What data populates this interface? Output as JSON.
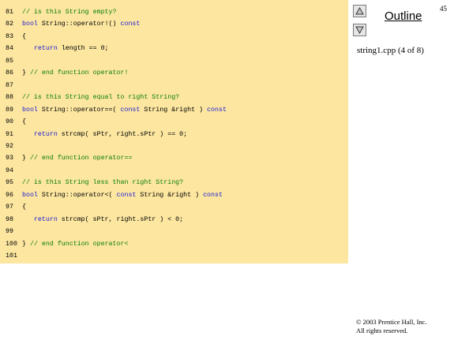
{
  "slide_number": "45",
  "outline_label": "Outline",
  "file_label": "string1.cpp (4 of 8)",
  "copyright": [
    "© 2003 Prentice Hall, Inc.",
    "All rights reserved."
  ],
  "nav": {
    "up_icon": "triangle-up-icon",
    "down_icon": "triangle-down-icon"
  },
  "colors": {
    "panel": "#fce6a0",
    "comment": "#0a7d0a",
    "keyword": "#1a1ad8"
  },
  "code_lines": [
    {
      "n": "81",
      "segs": [
        {
          "t": "// is this String empty?",
          "c": "comment"
        }
      ]
    },
    {
      "n": "82",
      "segs": [
        {
          "t": "bool",
          "c": "kw"
        },
        {
          "t": " String::operator!() ",
          "c": "plain"
        },
        {
          "t": "const",
          "c": "kw"
        }
      ]
    },
    {
      "n": "83",
      "segs": [
        {
          "t": "{",
          "c": "plain"
        }
      ]
    },
    {
      "n": "84",
      "segs": [
        {
          "t": "   ",
          "c": "plain"
        },
        {
          "t": "return",
          "c": "kw"
        },
        {
          "t": " length == 0;",
          "c": "plain"
        }
      ]
    },
    {
      "n": "85",
      "segs": []
    },
    {
      "n": "86",
      "segs": [
        {
          "t": "} ",
          "c": "plain"
        },
        {
          "t": "// end function operator!",
          "c": "comment"
        }
      ]
    },
    {
      "n": "87",
      "segs": []
    },
    {
      "n": "88",
      "segs": [
        {
          "t": "// is this String equal to right String?",
          "c": "comment"
        }
      ]
    },
    {
      "n": "89",
      "segs": [
        {
          "t": "bool",
          "c": "kw"
        },
        {
          "t": " String::operator==( ",
          "c": "plain"
        },
        {
          "t": "const",
          "c": "kw"
        },
        {
          "t": " String &right ) ",
          "c": "plain"
        },
        {
          "t": "const",
          "c": "kw"
        }
      ]
    },
    {
      "n": "90",
      "segs": [
        {
          "t": "{",
          "c": "plain"
        }
      ]
    },
    {
      "n": "91",
      "segs": [
        {
          "t": "   ",
          "c": "plain"
        },
        {
          "t": "return",
          "c": "kw"
        },
        {
          "t": " strcmp( sPtr, right.sPtr ) == 0;",
          "c": "plain"
        }
      ]
    },
    {
      "n": "92",
      "segs": []
    },
    {
      "n": "93",
      "segs": [
        {
          "t": "} ",
          "c": "plain"
        },
        {
          "t": "// end function operator==",
          "c": "comment"
        }
      ]
    },
    {
      "n": "94",
      "segs": []
    },
    {
      "n": "95",
      "segs": [
        {
          "t": "// is this String less than right String?",
          "c": "comment"
        }
      ]
    },
    {
      "n": "96",
      "segs": [
        {
          "t": "bool",
          "c": "kw"
        },
        {
          "t": " String::operator<( ",
          "c": "plain"
        },
        {
          "t": "const",
          "c": "kw"
        },
        {
          "t": " String &right ) ",
          "c": "plain"
        },
        {
          "t": "const",
          "c": "kw"
        }
      ]
    },
    {
      "n": "97",
      "segs": [
        {
          "t": "{",
          "c": "plain"
        }
      ]
    },
    {
      "n": "98",
      "segs": [
        {
          "t": "   ",
          "c": "plain"
        },
        {
          "t": "return",
          "c": "kw"
        },
        {
          "t": " strcmp( sPtr, right.sPtr ) < 0;",
          "c": "plain"
        }
      ]
    },
    {
      "n": "99",
      "segs": []
    },
    {
      "n": "100",
      "segs": [
        {
          "t": "} ",
          "c": "plain"
        },
        {
          "t": "// end function operator<",
          "c": "comment"
        }
      ]
    },
    {
      "n": "101",
      "segs": []
    }
  ]
}
